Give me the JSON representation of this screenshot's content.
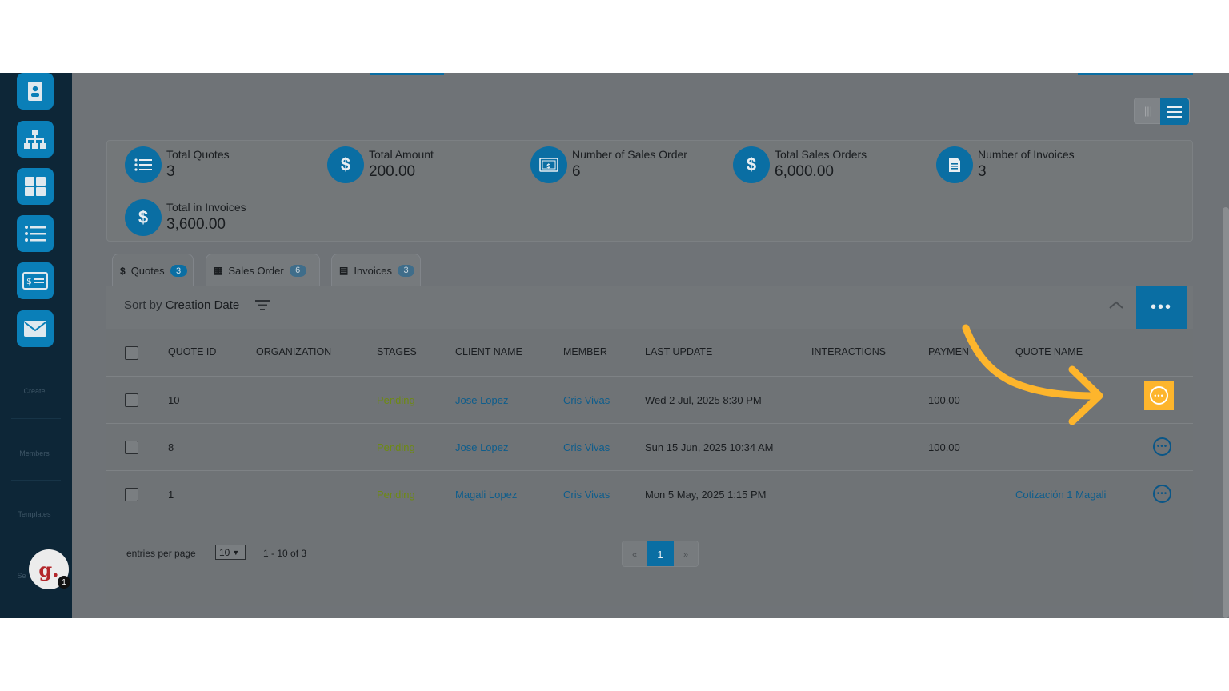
{
  "sidebar": {
    "icons": [
      "contact-card-icon",
      "org-chart-icon",
      "grid-icon",
      "list-icon",
      "billing-icon",
      "mail-icon"
    ],
    "labels": [
      "Create",
      "Members",
      "Templates",
      "Se"
    ],
    "avatar_letter": "g.",
    "avatar_badge": "1"
  },
  "stats": [
    {
      "label": "Total Quotes",
      "value": "3",
      "icon": "list-icon"
    },
    {
      "label": "Total Amount",
      "value": "200.00",
      "icon": "dollar-icon"
    },
    {
      "label": "Number of Sales Order",
      "value": "6",
      "icon": "sales-order-icon"
    },
    {
      "label": "Total Sales Orders",
      "value": "6,000.00",
      "icon": "dollar-icon"
    },
    {
      "label": "Number of Invoices",
      "value": "3",
      "icon": "invoice-icon"
    },
    {
      "label": "Total in Invoices",
      "value": "3,600.00",
      "icon": "dollar-icon"
    }
  ],
  "tabs": [
    {
      "label": "Quotes",
      "count": "3",
      "icon_glyph": "$",
      "active": true
    },
    {
      "label": "Sales Order",
      "count": "6",
      "icon_glyph": "▦",
      "active": false
    },
    {
      "label": "Invoices",
      "count": "3",
      "icon_glyph": "▤",
      "active": false
    }
  ],
  "sort": {
    "prefix": "Sort by",
    "field": "Creation Date"
  },
  "table": {
    "headers": [
      "QUOTE ID",
      "ORGANIZATION",
      "STAGES",
      "CLIENT NAME",
      "MEMBER",
      "LAST UPDATE",
      "INTERACTIONS",
      "PAYMEN",
      "QUOTE NAME"
    ],
    "rows": [
      {
        "quote_id": "10",
        "organization": "",
        "stage": "Pending",
        "client": "Jose Lopez",
        "member": "Cris Vivas",
        "last_update": "Wed 2 Jul, 2025 8:30 PM",
        "interactions": "",
        "payment": "100.00",
        "quote_name": ""
      },
      {
        "quote_id": "8",
        "organization": "",
        "stage": "Pending",
        "client": "Jose Lopez",
        "member": "Cris Vivas",
        "last_update": "Sun 15 Jun, 2025 10:34 AM",
        "interactions": "",
        "payment": "100.00",
        "quote_name": ""
      },
      {
        "quote_id": "1",
        "organization": "",
        "stage": "Pending",
        "client": "Magali Lopez",
        "member": "Cris Vivas",
        "last_update": "Mon 5 May, 2025 1:15 PM",
        "interactions": "",
        "payment": "",
        "quote_name": "Cotización 1 Magali"
      }
    ]
  },
  "footer": {
    "entries_label": "entries per page",
    "entries_value": "10",
    "range": "1 - 10 of 3",
    "pager_prev": "«",
    "pager_current": "1",
    "pager_next": "»"
  },
  "more_dots": "•••",
  "colors": {
    "accent": "#0a6ea3",
    "highlight": "#fdb52c",
    "sidebar": "#0d2637"
  }
}
